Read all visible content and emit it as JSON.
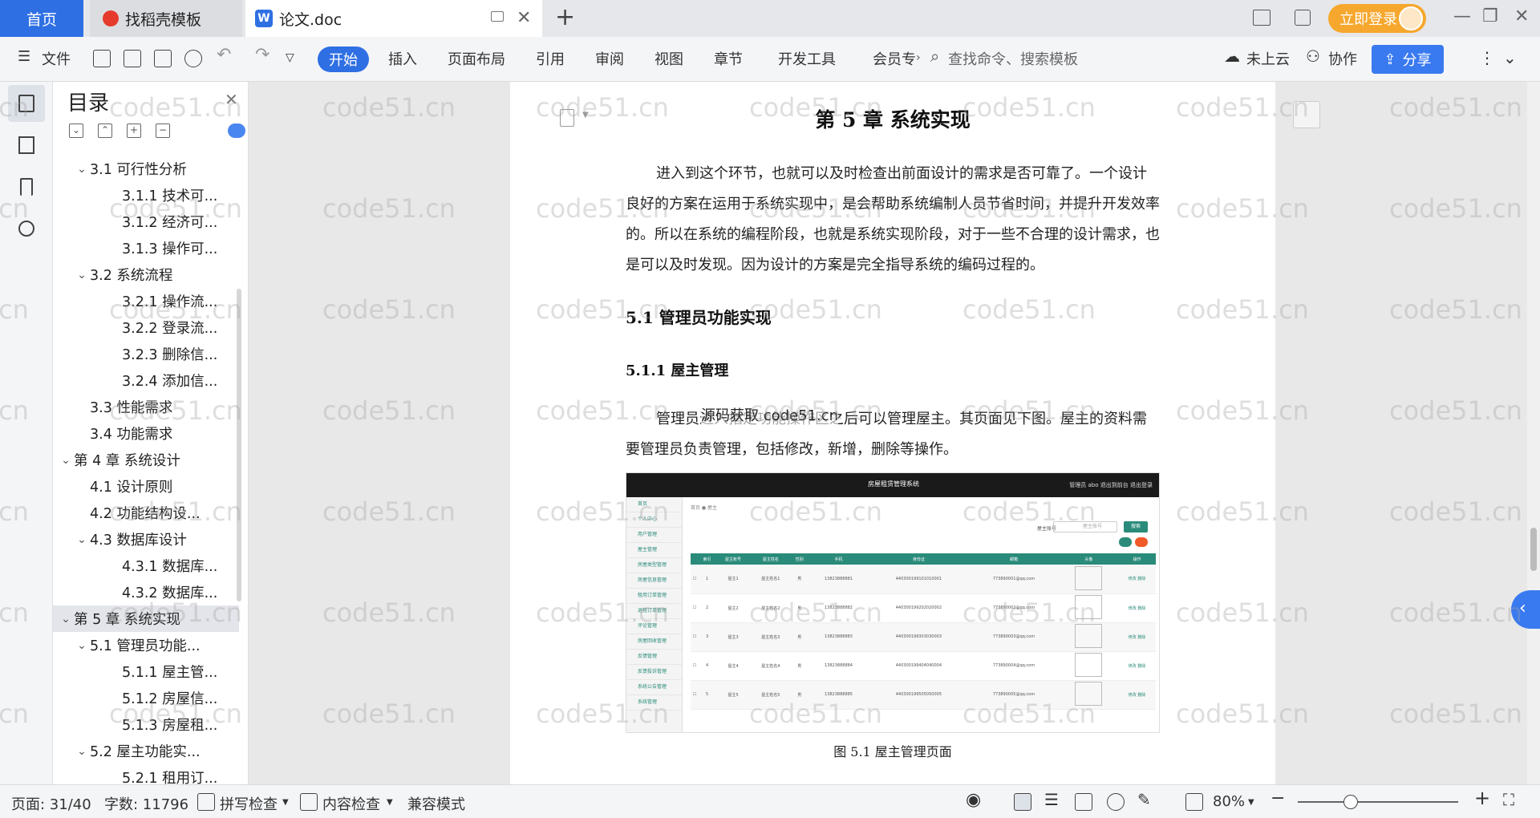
{
  "tabs": {
    "home": "首页",
    "templates": "找稻壳模板",
    "document": "论文.doc",
    "new_tab": "+"
  },
  "title_bar": {
    "login": "立即登录",
    "minimize": "—",
    "restore": "❐",
    "close": "✕"
  },
  "toolbar": {
    "file": "文件",
    "start": "开始",
    "insert": "插入",
    "page_layout": "页面布局",
    "references": "引用",
    "review": "审阅",
    "view": "视图",
    "chapter": "章节",
    "dev_tools": "开发工具",
    "member": "会员专",
    "search_placeholder": "查找命令、搜索模板",
    "cloud": "未上云",
    "collab": "协作",
    "share": "分享"
  },
  "toc": {
    "title": "目录",
    "items": [
      {
        "label": "3.1 可行性分析",
        "level": 2,
        "expanded": true
      },
      {
        "label": "3.1.1 技术可...",
        "level": 3
      },
      {
        "label": "3.1.2 经济可...",
        "level": 3
      },
      {
        "label": "3.1.3 操作可...",
        "level": 3
      },
      {
        "label": "3.2 系统流程",
        "level": 2,
        "expanded": true
      },
      {
        "label": "3.2.1 操作流...",
        "level": 3
      },
      {
        "label": "3.2.2 登录流...",
        "level": 3
      },
      {
        "label": "3.2.3 删除信...",
        "level": 3
      },
      {
        "label": "3.2.4 添加信...",
        "level": 3
      },
      {
        "label": "3.3 性能需求",
        "level": 2
      },
      {
        "label": "3.4 功能需求",
        "level": 2
      },
      {
        "label": "第 4 章 系统设计",
        "level": 1,
        "expanded": true
      },
      {
        "label": "4.1 设计原则",
        "level": 2
      },
      {
        "label": "4.2 功能结构设...",
        "level": 2
      },
      {
        "label": "4.3 数据库设计",
        "level": 2,
        "expanded": true
      },
      {
        "label": "4.3.1 数据库...",
        "level": 3
      },
      {
        "label": "4.3.2 数据库...",
        "level": 3
      },
      {
        "label": "第 5 章 系统实现",
        "level": 1,
        "expanded": true,
        "selected": true
      },
      {
        "label": "5.1 管理员功能...",
        "level": 2,
        "expanded": true
      },
      {
        "label": "5.1.1 屋主管...",
        "level": 3
      },
      {
        "label": "5.1.2 房屋信...",
        "level": 3
      },
      {
        "label": "5.1.3 房屋租...",
        "level": 3
      },
      {
        "label": "5.2 屋主功能实...",
        "level": 2,
        "expanded": true
      },
      {
        "label": "5.2.1 租用订...",
        "level": 3
      }
    ]
  },
  "document": {
    "chapter_title": "第 5 章 系统实现",
    "intro": "进入到这个环节，也就可以及时检查出前面设计的需求是否可靠了。一个设计良好的方案在运用于系统实现中，是会帮助系统编制人员节省时间，并提升开发效率的。所以在系统的编程阶段，也就是系统实现阶段，对于一些不合理的设计需求，也是可以及时发现。因为设计的方案是完全指导系统的编码过程的。",
    "section": "5.1 管理员功能实现",
    "subsection": "5.1.1 屋主管理",
    "body": "管理员进入指定功能操作区之后可以管理屋主。其页面见下图。屋主的资料需要管理员负责管理，包括修改，新增，删除等操作。",
    "overlay": "源码获取 code51.cn",
    "caption": "图 5.1 屋主管理页面"
  },
  "screenshot": {
    "app_title": "房屋租赁管理系统",
    "header_links": "管理员 abo   退出到前台   退出登录",
    "breadcrumb": "首页 ● 屋主",
    "search_label": "屋主账号",
    "search_placeholder": "屋主账号",
    "search_btn": "搜索",
    "side_items": [
      "首页",
      "个人中心",
      "用户管理",
      "屋主管理",
      "房屋类型管理",
      "房屋信息管理",
      "租用订单管理",
      "退租订单管理",
      "评论管理",
      "房屋回收管理",
      "反馈管理",
      "反馈投诉管理",
      "系统公告管理",
      "系统管理"
    ],
    "columns": [
      "",
      "索引",
      "屋主账号",
      "屋主姓名",
      "性别",
      "手机",
      "身份证",
      "邮箱",
      "头像",
      "操作"
    ],
    "rows": [
      [
        "1",
        "屋主1",
        "屋主姓名1",
        "男",
        "13823888881",
        "440300199101010001",
        "773890001@qq.com"
      ],
      [
        "2",
        "屋主2",
        "屋主姓名2",
        "男",
        "13823888882",
        "440300199202020002",
        "773890002@qq.com"
      ],
      [
        "3",
        "屋主3",
        "屋主姓名3",
        "男",
        "13823888883",
        "440300199303030003",
        "773890003@qq.com"
      ],
      [
        "4",
        "屋主4",
        "屋主姓名4",
        "男",
        "13823888884",
        "440300199404040004",
        "773890004@qq.com"
      ],
      [
        "5",
        "屋主5",
        "屋主姓名5",
        "男",
        "13823888885",
        "440300199505050005",
        "773890005@qq.com"
      ]
    ],
    "op_edit": "修改",
    "op_delete": "删除"
  },
  "status": {
    "page": "页面: 31/40",
    "words": "字数: 11796",
    "spell": "拼写检查",
    "content": "内容检查",
    "compat": "兼容模式",
    "zoom": "80%",
    "zoom_level": 0.33
  },
  "watermark": "code51.cn",
  "colors": {
    "accent": "#2f6fe4",
    "login": "#f6a72d",
    "screenshot_accent": "#2a8b7a"
  }
}
